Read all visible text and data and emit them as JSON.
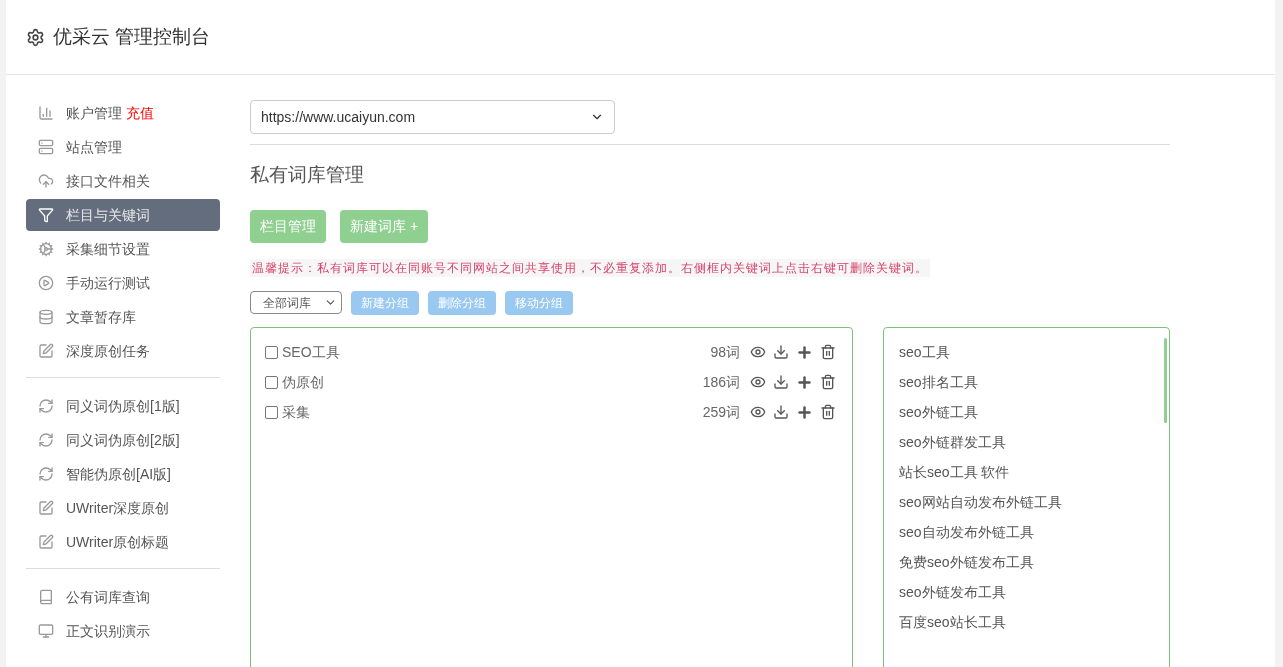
{
  "header": {
    "title": "优采云 管理控制台"
  },
  "sidebar": {
    "groups": [
      {
        "items": [
          {
            "label": "账户管理",
            "badge": "充值",
            "selected": false
          },
          {
            "label": "站点管理",
            "selected": false
          },
          {
            "label": "接口文件相关",
            "selected": false
          },
          {
            "label": "栏目与关键词",
            "selected": true
          },
          {
            "label": "采集细节设置",
            "selected": false
          },
          {
            "label": "手动运行测试",
            "selected": false
          },
          {
            "label": "文章暂存库",
            "selected": false
          },
          {
            "label": "深度原创任务",
            "selected": false
          }
        ]
      },
      {
        "items": [
          {
            "label": "同义词伪原创[1版]",
            "selected": false
          },
          {
            "label": "同义词伪原创[2版]",
            "selected": false
          },
          {
            "label": "智能伪原创[AI版]",
            "selected": false
          },
          {
            "label": "UWriter深度原创",
            "selected": false
          },
          {
            "label": "UWriter原创标题",
            "selected": false
          }
        ]
      },
      {
        "items": [
          {
            "label": "公有词库查询",
            "selected": false
          },
          {
            "label": "正文识别演示",
            "selected": false
          }
        ]
      }
    ]
  },
  "site_select": {
    "value": "https://www.ucaiyun.com"
  },
  "section_title": "私有词库管理",
  "primary_buttons": [
    "栏目管理",
    "新建词库 +"
  ],
  "tip": "温馨提示：私有词库可以在同账号不同网站之间共享使用，不必重复添加。右侧框内关键词上点击右键可删除关键词。",
  "filter_select": {
    "value": "全部词库"
  },
  "group_buttons": [
    "新建分组",
    "删除分组",
    "移动分组"
  ],
  "libraries": [
    {
      "name": "SEO工具",
      "count": "98词",
      "checked": false
    },
    {
      "name": "伪原创",
      "count": "186词",
      "checked": false
    },
    {
      "name": "采集",
      "count": "259词",
      "checked": false
    }
  ],
  "keywords": [
    "seo工具",
    "seo排名工具",
    "seo外链工具",
    "seo外链群发工具",
    "站长seo工具 软件",
    "seo网站自动发布外链工具",
    "seo自动发布外链工具",
    "免费seo外链发布工具",
    "seo外链发布工具",
    "百度seo站长工具"
  ]
}
